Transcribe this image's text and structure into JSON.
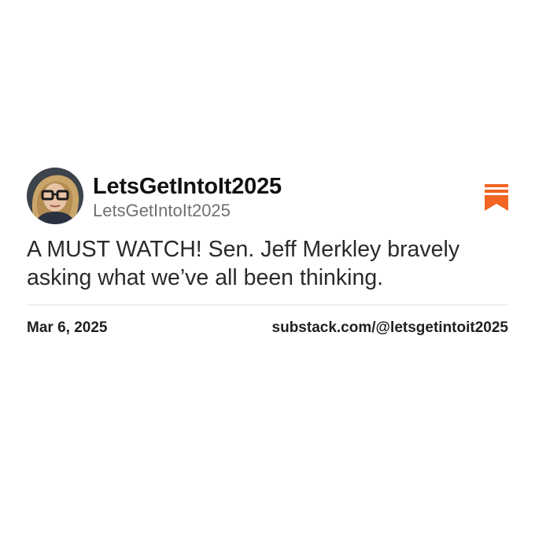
{
  "post": {
    "display_name": "LetsGetIntoIt2025",
    "handle": "LetsGetIntoIt2025",
    "text": "A MUST WATCH! Sen. Jeff Merkley bravely asking what we’ve all been thinking.",
    "date": "Mar 6, 2025",
    "source_url": "substack.com/@letsgetintoit2025"
  },
  "icons": {
    "avatar": "profile-photo",
    "brand": "substack-bookmark-icon"
  },
  "colors": {
    "brand_accent": "#F26522",
    "handle_text": "#707070",
    "divider": "#E4E4E4"
  }
}
